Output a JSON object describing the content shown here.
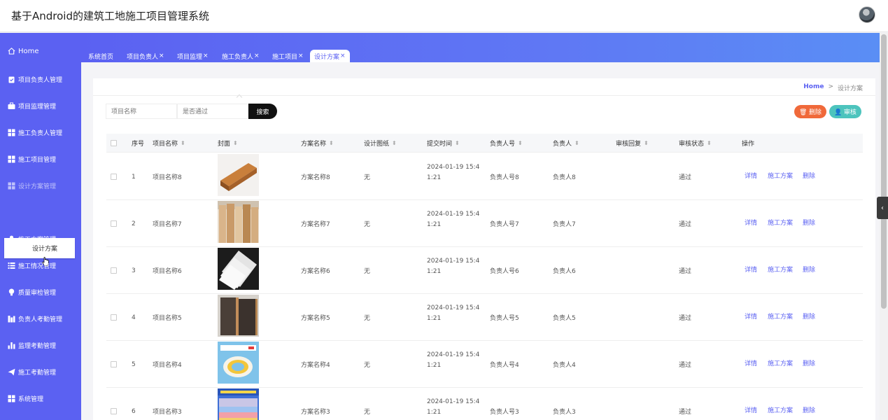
{
  "app": {
    "title": "基于Android的建筑工地施工项目管理系统"
  },
  "sidebar": {
    "home": "Home",
    "items": [
      {
        "label": "项目负责人管理",
        "icon": "clipboard-icon"
      },
      {
        "label": "项目监理管理",
        "icon": "briefcase-icon"
      },
      {
        "label": "施工负责人管理",
        "icon": "grid-icon"
      },
      {
        "label": "施工项目管理",
        "icon": "grid-icon"
      },
      {
        "label": "设计方案管理",
        "icon": "grid-icon"
      },
      {
        "label": "施工方案管理",
        "icon": "user-icon"
      },
      {
        "label": "施工情况管理",
        "icon": "list-icon"
      },
      {
        "label": "质量审检管理",
        "icon": "bulb-icon"
      },
      {
        "label": "负责人考勤管理",
        "icon": "chart-icon"
      },
      {
        "label": "监理考勤管理",
        "icon": "bar-chart-icon"
      },
      {
        "label": "施工考勤管理",
        "icon": "send-icon"
      },
      {
        "label": "系统管理",
        "icon": "grid-icon"
      }
    ],
    "submenu_item": "设计方案"
  },
  "tabs": [
    {
      "label": "系统首页",
      "closable": false
    },
    {
      "label": "项目负责人",
      "closable": true
    },
    {
      "label": "项目监理",
      "closable": true
    },
    {
      "label": "施工负责人",
      "closable": true
    },
    {
      "label": "施工项目",
      "closable": true
    },
    {
      "label": "设计方案",
      "closable": true,
      "active": true
    }
  ],
  "tab_close_glyph": "×",
  "breadcrumb": {
    "home": "Home",
    "separator": ">",
    "current": "设计方案"
  },
  "search": {
    "name_placeholder": "项目名称",
    "pass_placeholder": "是否通过",
    "button": "搜索"
  },
  "actions": {
    "delete": "删除",
    "audit": "审核"
  },
  "table": {
    "headers": {
      "index": "序号",
      "project_name": "项目名称",
      "cover": "封面",
      "scheme_name": "方案名称",
      "drawing": "设计图纸",
      "submit_time": "提交时间",
      "owner_id": "负责人号",
      "owner": "负责人",
      "reply": "审核回复",
      "status": "审核状态",
      "ops": "操作"
    },
    "sort_glyph": "⬍",
    "rows": [
      {
        "index": "1",
        "project_name": "项目名称8",
        "scheme_name": "方案名称8",
        "drawing": "无",
        "submit_time": "2024-01-19 15:41:21",
        "owner_id": "负责人号8",
        "owner": "负责人8",
        "status": "通过",
        "cover": "orange-pipe"
      },
      {
        "index": "2",
        "project_name": "项目名称7",
        "scheme_name": "方案名称7",
        "drawing": "无",
        "submit_time": "2024-01-19 15:41:21",
        "owner_id": "负责人号7",
        "owner": "负责人7",
        "status": "通过",
        "cover": "veneer-rolls"
      },
      {
        "index": "3",
        "project_name": "项目名称6",
        "scheme_name": "方案名称6",
        "drawing": "无",
        "submit_time": "2024-01-19 15:41:21",
        "owner_id": "负责人号6",
        "owner": "负责人6",
        "status": "通过",
        "cover": "white-boards"
      },
      {
        "index": "4",
        "project_name": "项目名称5",
        "scheme_name": "方案名称5",
        "drawing": "无",
        "submit_time": "2024-01-19 15:41:21",
        "owner_id": "负责人号5",
        "owner": "负责人5",
        "status": "通过",
        "cover": "dark-panels"
      },
      {
        "index": "5",
        "project_name": "项目名称4",
        "scheme_name": "方案名称4",
        "drawing": "无",
        "submit_time": "2024-01-19 15:41:21",
        "owner_id": "负责人号4",
        "owner": "负责人4",
        "status": "通过",
        "cover": "tape-roll"
      },
      {
        "index": "6",
        "project_name": "项目名称3",
        "scheme_name": "方案名称3",
        "drawing": "无",
        "submit_time": "2024-01-19 15:41:21",
        "owner_id": "负责人号3",
        "owner": "负责人3",
        "status": "通过",
        "cover": "color-boards"
      }
    ],
    "row_ops": {
      "detail": "详情",
      "plan": "施工方案",
      "delete": "删除"
    }
  },
  "colors": {
    "accent": "#5b61f2",
    "delete": "#f0693a",
    "audit": "#4dc4bd"
  }
}
